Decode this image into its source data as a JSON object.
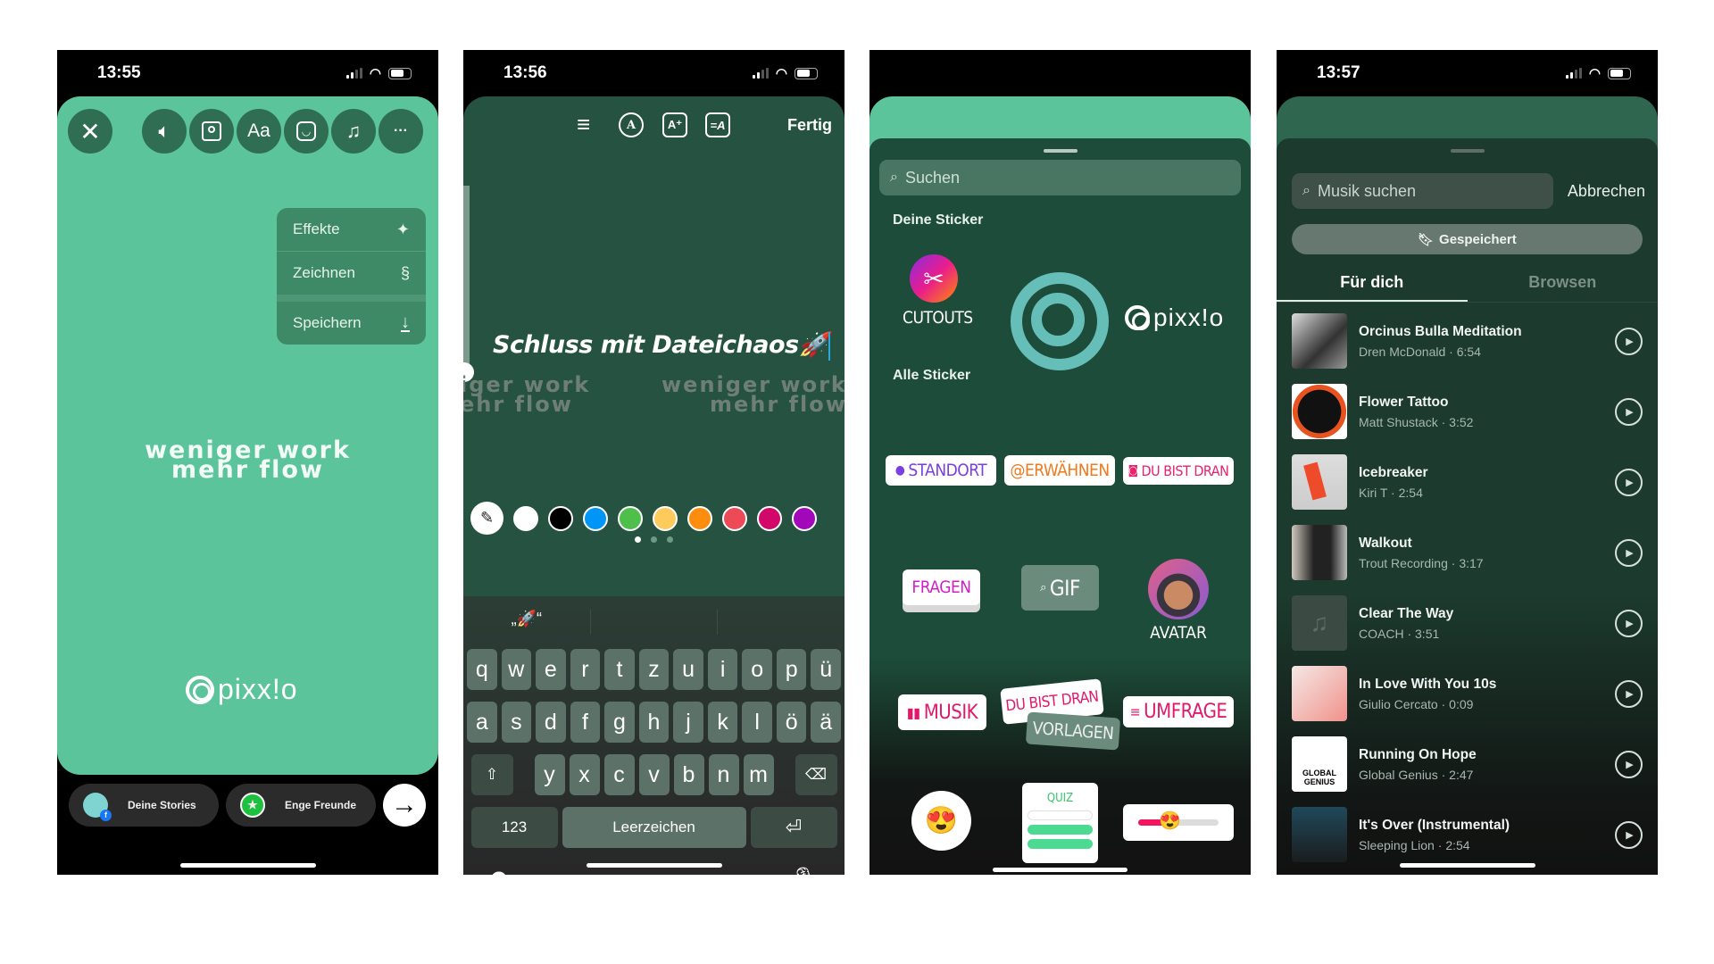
{
  "phones": [
    {
      "time": "13:55",
      "toolbar": {
        "close_icon": "close-icon",
        "items": [
          "sound-icon",
          "tag-person-icon",
          "Aa",
          "sticker-icon",
          "music-icon",
          "more-icon"
        ],
        "text_label": "Aa",
        "more_label": "···"
      },
      "menu": [
        {
          "label": "Effekte",
          "icon": "sparkles-icon"
        },
        {
          "label": "Zeichnen",
          "icon": "scribble-icon"
        },
        {
          "label": "Speichern",
          "icon": "download-icon"
        }
      ],
      "story_text": {
        "line1": "weniger work",
        "line2": "mehr flow"
      },
      "logo_text": "pixx!o",
      "share": {
        "your_stories": "Deine Stories",
        "close_friends": "Enge Freunde",
        "next_icon": "arrow-right-icon",
        "next_glyph": "→"
      }
    },
    {
      "time": "13:56",
      "tools": {
        "align_icon": "≡",
        "font_icon": "A",
        "effect_icon": "A⁺",
        "anim_icon": "=A",
        "done": "Fertig"
      },
      "headline": "Schluss mit Dateichaos🚀",
      "ghost_left": {
        "line1": "iger work",
        "line2": "ehr flow"
      },
      "ghost_right": {
        "line1": "weniger work",
        "line2": "mehr flow"
      },
      "colors": [
        "#ffffff",
        "#000000",
        "#0095f6",
        "#4fbf4c",
        "#fdcb5c",
        "#fd8d0e",
        "#ed4956",
        "#d10869",
        "#a307ba"
      ],
      "color_pages": 3,
      "color_page_active": 1,
      "suggestions": [
        "„🚀“",
        "",
        ""
      ],
      "keyboard": {
        "row1": [
          "q",
          "w",
          "e",
          "r",
          "t",
          "z",
          "u",
          "i",
          "o",
          "p",
          "ü"
        ],
        "row2": [
          "a",
          "s",
          "d",
          "f",
          "g",
          "h",
          "j",
          "k",
          "l",
          "ö",
          "ä"
        ],
        "row3": [
          "y",
          "x",
          "c",
          "v",
          "b",
          "n",
          "m"
        ],
        "shift": "⇧",
        "backspace": "⌫",
        "numbers": "123",
        "space": "Leerzeichen",
        "return": "⏎",
        "emoji": "☻",
        "mic": "🎙"
      }
    },
    {
      "search_placeholder": "Suchen",
      "your_stickers_label": "Deine Sticker",
      "cutouts_label": "CUTOUTS",
      "logo_text": "pixx!o",
      "all_stickers_label": "Alle Sticker",
      "stickers": {
        "location": "STANDORT",
        "mention": "@ERWÄHNEN",
        "add_yours": "DU BIST DRAN",
        "questions": "FRAGEN",
        "gif": "GIF",
        "avatar": "AVATAR",
        "music": "MUSIK",
        "add_yours_2": "DU BIST DRAN",
        "templates": "VORLAGEN",
        "poll": "UMFRAGE",
        "quiz": "QUIZ"
      },
      "colors": {
        "location": "#7a3fe4",
        "mention": "#f07a1c",
        "add_yours": "#e8226b",
        "questions": "#d21fc4",
        "music": "#e0196b",
        "poll": "#e0196b",
        "quiz": "#35c46e"
      }
    },
    {
      "time": "13:57",
      "search_placeholder": "Musik suchen",
      "cancel": "Abbrechen",
      "saved": "Gespeichert",
      "tabs": [
        "Für dich",
        "Browsen"
      ],
      "active_tab": 0,
      "songs": [
        {
          "title": "Orcinus Bulla Meditation",
          "artist": "Dren McDonald",
          "duration": "6:54"
        },
        {
          "title": "Flower Tattoo",
          "artist": "Matt Shustack",
          "duration": "3:52"
        },
        {
          "title": "Icebreaker",
          "artist": "Kiri T",
          "duration": "2:54"
        },
        {
          "title": "Walkout",
          "artist": "Trout Recording",
          "duration": "3:17"
        },
        {
          "title": "Clear The Way",
          "artist": "COACH",
          "duration": "3:51"
        },
        {
          "title": "In Love With You 10s",
          "artist": "Giulio Cercato",
          "duration": "0:09"
        },
        {
          "title": "Running On Hope",
          "artist": "Global Genius",
          "duration": "2:47"
        },
        {
          "title": "It's Over (Instrumental)",
          "artist": "Sleeping Lion",
          "duration": "2:54"
        }
      ],
      "art_label_global": "GLOBAL GENIUS"
    }
  ]
}
